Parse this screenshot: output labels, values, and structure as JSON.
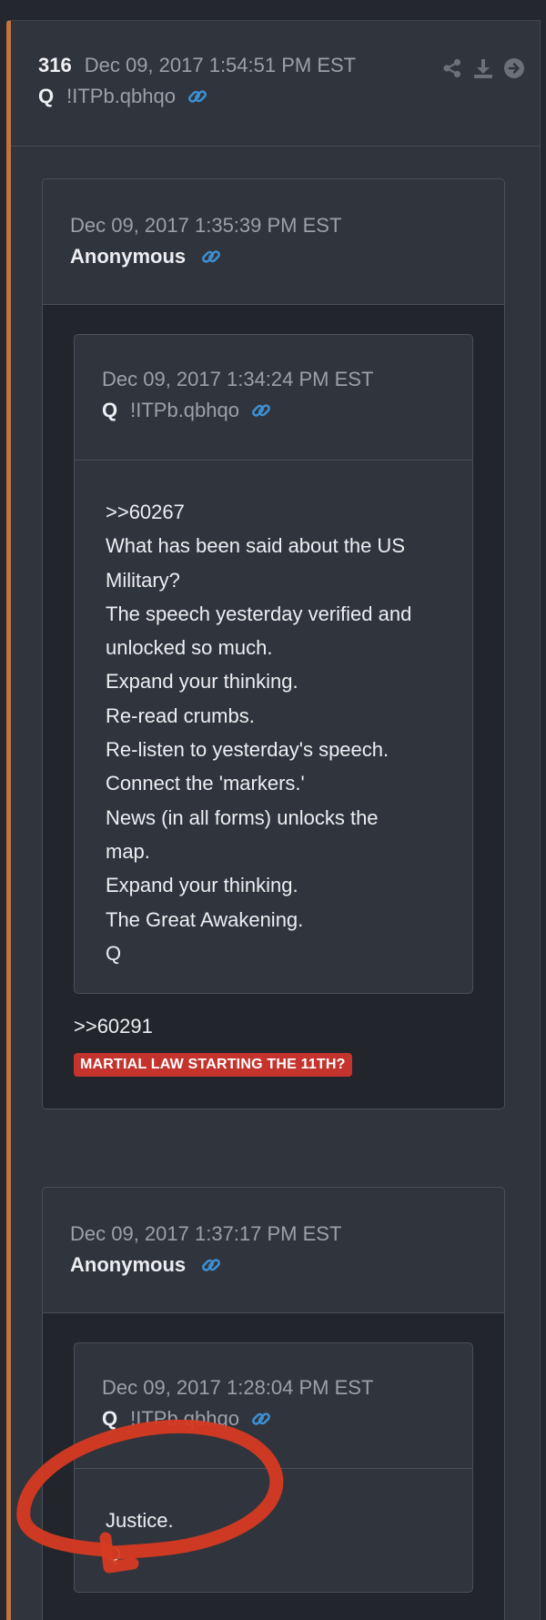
{
  "post": {
    "number": "316",
    "date": "Dec 09, 2017 1:54:51 PM EST",
    "author": "Q",
    "tripcode": "!ITPb.qbhqo"
  },
  "quotes": [
    {
      "date": "Dec 09, 2017 1:35:39 PM EST",
      "author": "Anonymous",
      "inner": {
        "date": "Dec 09, 2017 1:34:24 PM EST",
        "author": "Q",
        "tripcode": "!ITPb.qbhqo",
        "lines": [
          ">>60267",
          "What has been said about the US",
          "Military?",
          "The speech yesterday verified and",
          "unlocked so much.",
          "Expand your thinking.",
          "Re-read crumbs.",
          "Re-listen to yesterday's speech.",
          "Connect the 'markers.'",
          "News (in all forms) unlocks the",
          "map.",
          "Expand your thinking.",
          "The Great Awakening.",
          "Q"
        ]
      },
      "reply_ref": ">>60291",
      "tag": "MARTIAL LAW STARTING THE 11TH?"
    },
    {
      "date": "Dec 09, 2017 1:37:17 PM EST",
      "author": "Anonymous",
      "inner": {
        "date": "Dec 09, 2017 1:28:04 PM EST",
        "author": "Q",
        "tripcode": "!ITPb.qbhqo",
        "lines": [
          "Justice.",
          "Q"
        ]
      }
    }
  ],
  "icons": {
    "link": "link-icon",
    "share": "share-icon",
    "download": "download-icon",
    "go": "arrow-right-circle-icon"
  },
  "colors": {
    "accent_border": "#c4733a",
    "link": "#3d8fd1",
    "badge": "#c4342d",
    "annotation": "#d63a22"
  }
}
